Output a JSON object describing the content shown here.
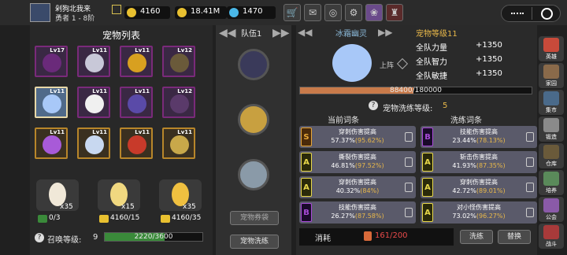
{
  "header": {
    "player_name": "剁狗北我来",
    "player_rank": "勇者 1 - 8阶",
    "resources": [
      {
        "value": "4160",
        "icon": "gold-egg-icon",
        "color": "#e8c030"
      },
      {
        "value": "18.41M",
        "icon": "coin-icon",
        "color": "#e8c030"
      },
      {
        "value": "1470",
        "icon": "diamond-icon",
        "color": "#4ab8e8"
      }
    ],
    "toolbar": [
      "shop-icon",
      "mail-icon",
      "gamepad-icon",
      "gear-icon",
      "gift-icon",
      "event-icon"
    ]
  },
  "pet_list": {
    "title": "宠物列表",
    "slots": [
      {
        "level": "Lv17",
        "border": "purple",
        "art": "#6a2a7a"
      },
      {
        "level": "Lv11",
        "border": "purple",
        "art": "#c8c8d8"
      },
      {
        "level": "Lv11",
        "border": "purple",
        "art": "#d8a020"
      },
      {
        "level": "Lv12",
        "border": "purple",
        "art": "#6a5a3a"
      },
      {
        "level": "Lv11",
        "border": "selected",
        "art": "#a8c8f8"
      },
      {
        "level": "Lv11",
        "border": "purple",
        "art": "#f0f0f0"
      },
      {
        "level": "Lv11",
        "border": "purple",
        "art": "#5a4aa8"
      },
      {
        "level": "Lv12",
        "border": "purple",
        "art": "#5a3a6a"
      },
      {
        "level": "Lv11",
        "border": "gold",
        "art": "#a85ad8"
      },
      {
        "level": "Lv11",
        "border": "gold",
        "art": "#c8d8f0"
      },
      {
        "level": "Lv11",
        "border": "gold",
        "art": "#c83a2a"
      },
      {
        "level": "Lv11",
        "border": "gold",
        "art": "#c8a84a"
      }
    ],
    "eggs": [
      {
        "count": "x35",
        "sub": "0/3",
        "color": "#f0e8d8"
      },
      {
        "count": "x15",
        "sub": "4160/15",
        "color": "#f0d880"
      },
      {
        "count": "x35",
        "sub": "4160/35",
        "color": "#f0c040"
      }
    ],
    "summon_label": "召唤等级:",
    "summon_level": "9",
    "summon_progress": "2220/3600",
    "summon_fraction": 0.6167
  },
  "team": {
    "tab_label": "队伍1",
    "slots": [
      {
        "art": "#3a3a5a"
      },
      {
        "art": "#c8a040"
      },
      {
        "art": "#8a9aa8"
      }
    ],
    "btn_tokens": "宠物券袋",
    "btn_refine": "宠物洗练"
  },
  "detail": {
    "pet_name": "冰霜幽灵",
    "pet_level": "宠物等级11",
    "deploy_label": "上阵",
    "stats": [
      {
        "label": "全队力量",
        "value": "+1350"
      },
      {
        "label": "全队智力",
        "value": "+1350"
      },
      {
        "label": "全队敏捷",
        "value": "+1350"
      }
    ],
    "exp_text": "88400/180000",
    "exp_fraction": 0.4911,
    "refine_level_label": "宠物洗练等级:",
    "refine_level": "5",
    "current_title": "当前词条",
    "refine_title": "洗练词条",
    "current": [
      {
        "grade": "S",
        "name": "穿刺伤害提高",
        "pct": "57.37%",
        "range": "(95.62%)"
      },
      {
        "grade": "A",
        "name": "撕裂伤害提高",
        "pct": "46.81%",
        "range": "(97.52%)"
      },
      {
        "grade": "A",
        "name": "穿刺伤害提高",
        "pct": "40.32%",
        "range": "(84%)"
      },
      {
        "grade": "B",
        "name": "技能伤害提高",
        "pct": "26.27%",
        "range": "(87.58%)"
      }
    ],
    "refined": [
      {
        "grade": "B",
        "name": "技能伤害提高",
        "pct": "23.44%",
        "range": "(78.13%)"
      },
      {
        "grade": "A",
        "name": "斩击伤害提高",
        "pct": "41.93%",
        "range": "(87.35%)"
      },
      {
        "grade": "A",
        "name": "穿刺伤害提高",
        "pct": "42.72%",
        "range": "(89.01%)"
      },
      {
        "grade": "A",
        "name": "对小怪伤害提高",
        "pct": "73.02%",
        "range": "(96.27%)"
      }
    ],
    "consume_label": "消耗",
    "consume_value": "161/200",
    "btn_refine": "洗练",
    "btn_swap": "替换"
  },
  "sidenav": [
    {
      "label": "英雄",
      "color": "#c84a3a"
    },
    {
      "label": "家园",
      "color": "#8a6a4a"
    },
    {
      "label": "集市",
      "color": "#4a6a8a"
    },
    {
      "label": "锻造",
      "color": "#8a8a8a"
    },
    {
      "label": "仓库",
      "color": "#6a5a3a"
    },
    {
      "label": "培养",
      "color": "#5a8a5a"
    },
    {
      "label": "公会",
      "color": "#8a5aa8"
    },
    {
      "label": "战斗",
      "color": "#a83a3a"
    }
  ]
}
